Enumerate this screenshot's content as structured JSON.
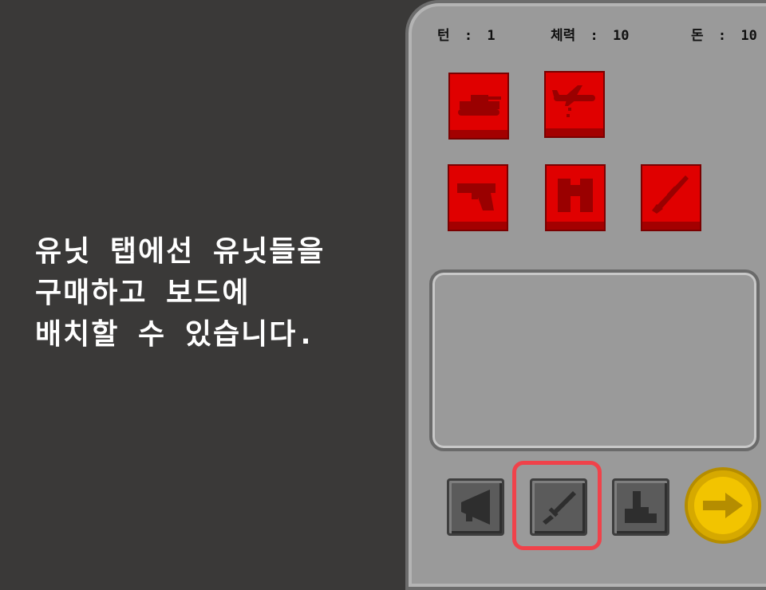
{
  "tutorial": {
    "lines": [
      "유닛 탭에선 유닛들을",
      "구매하고 보드에",
      "배치할 수 있습니다."
    ]
  },
  "stats": {
    "turn_label": "턴",
    "turn_value": "1",
    "health_label": "체력",
    "health_value": "10",
    "money_label": "돈",
    "money_value": "10",
    "separator": ":"
  },
  "units": [
    {
      "icon": "tank-icon"
    },
    {
      "icon": "bomber-plane-icon"
    },
    {
      "icon": "pistol-icon"
    },
    {
      "icon": "binoculars-icon"
    },
    {
      "icon": "sniper-rifle-icon"
    }
  ],
  "tabs": [
    {
      "icon": "megaphone-icon",
      "selected": false
    },
    {
      "icon": "knife-icon",
      "selected": true
    },
    {
      "icon": "buildings-icon",
      "selected": false
    }
  ],
  "colors": {
    "background": "#3a3938",
    "panel": "#9a9a9a",
    "unit_card": "#e00000",
    "highlight": "#f0424a",
    "next_button": "#f2c400"
  }
}
